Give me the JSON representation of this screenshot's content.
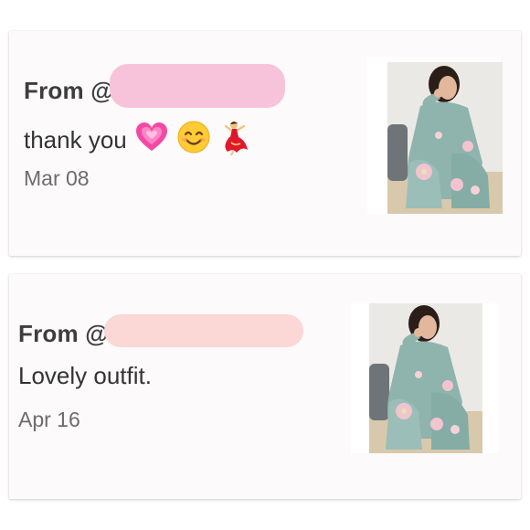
{
  "messages": [
    {
      "from_prefix": "From @",
      "text": "thank you",
      "date": "Mar 08",
      "emojis": [
        "pink-heart-icon",
        "smiling-face-icon",
        "flamenco-dancer-icon"
      ],
      "thumbnail": "outfit-photo"
    },
    {
      "from_prefix": "From @",
      "text": "Lovely outfit.",
      "date": "Apr 16",
      "emojis": [],
      "thumbnail": "outfit-photo"
    }
  ],
  "colors": {
    "redaction_1": "#f6c3da",
    "redaction_2": "#fbd7d5",
    "outfit": "#8fb3ad",
    "background_wall": "#e9e7e4"
  }
}
